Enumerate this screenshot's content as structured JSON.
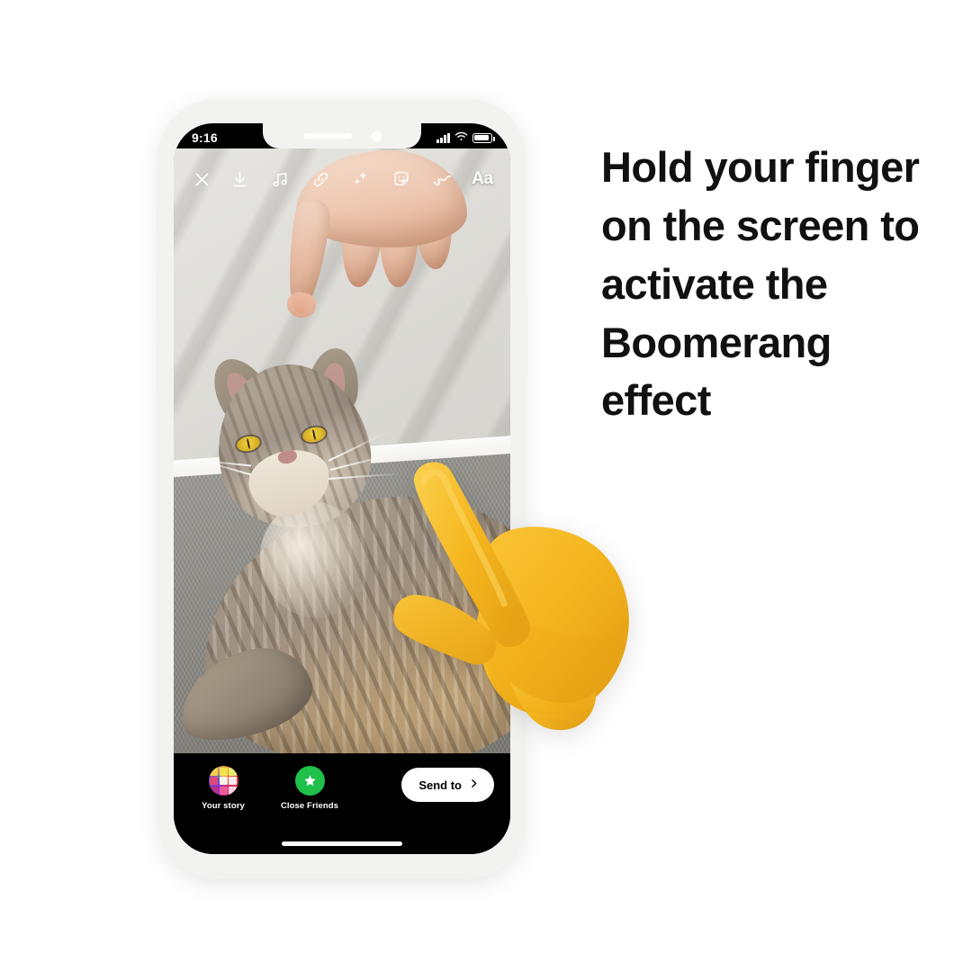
{
  "page": {
    "background_color": "#ffffff",
    "headline": "Hold your finger on the screen to activate the Boomerang effect"
  },
  "phone": {
    "frame_color": "#f2f2f0",
    "screen_background": "#000000",
    "status_bar": {
      "time": "9:16",
      "icons": [
        "cellular-signal-icon",
        "wifi-icon",
        "battery-icon"
      ],
      "battery_level_percent": 80
    },
    "notch": {
      "speaker": "earpiece-speaker",
      "camera": "front-camera"
    },
    "home_indicator": "home-indicator-bar"
  },
  "story_editor": {
    "close_label": "×",
    "close_icon": "close-icon",
    "tools": [
      {
        "name": "save-icon",
        "label": "Save"
      },
      {
        "name": "music-icon",
        "label": "Music"
      },
      {
        "name": "link-icon",
        "label": "Link"
      },
      {
        "name": "effects-icon",
        "label": "Effects"
      },
      {
        "name": "sticker-icon",
        "label": "Stickers"
      },
      {
        "name": "draw-icon",
        "label": "Draw"
      },
      {
        "name": "text-icon",
        "label": "Aa"
      }
    ],
    "text_tool_label": "Aa",
    "photo": {
      "description": "grey tabby cat lying on grey carpet looking up at a human hand pointing down",
      "wall_color": "#ded`d9",
      "carpet_color": "#8a8982"
    }
  },
  "share_bar": {
    "options": [
      {
        "icon": "your-story-icon",
        "label": "Your story"
      },
      {
        "icon": "close-friends-icon",
        "label": "Close Friends"
      }
    ],
    "send_button": {
      "label": "Send to",
      "icon": "chevron-right-icon"
    },
    "close_friends_color": "#1fc14a"
  },
  "overlay": {
    "emoji": "point-up-hand-emoji",
    "color": "#f7b824",
    "color_shadow": "#e09a12"
  }
}
